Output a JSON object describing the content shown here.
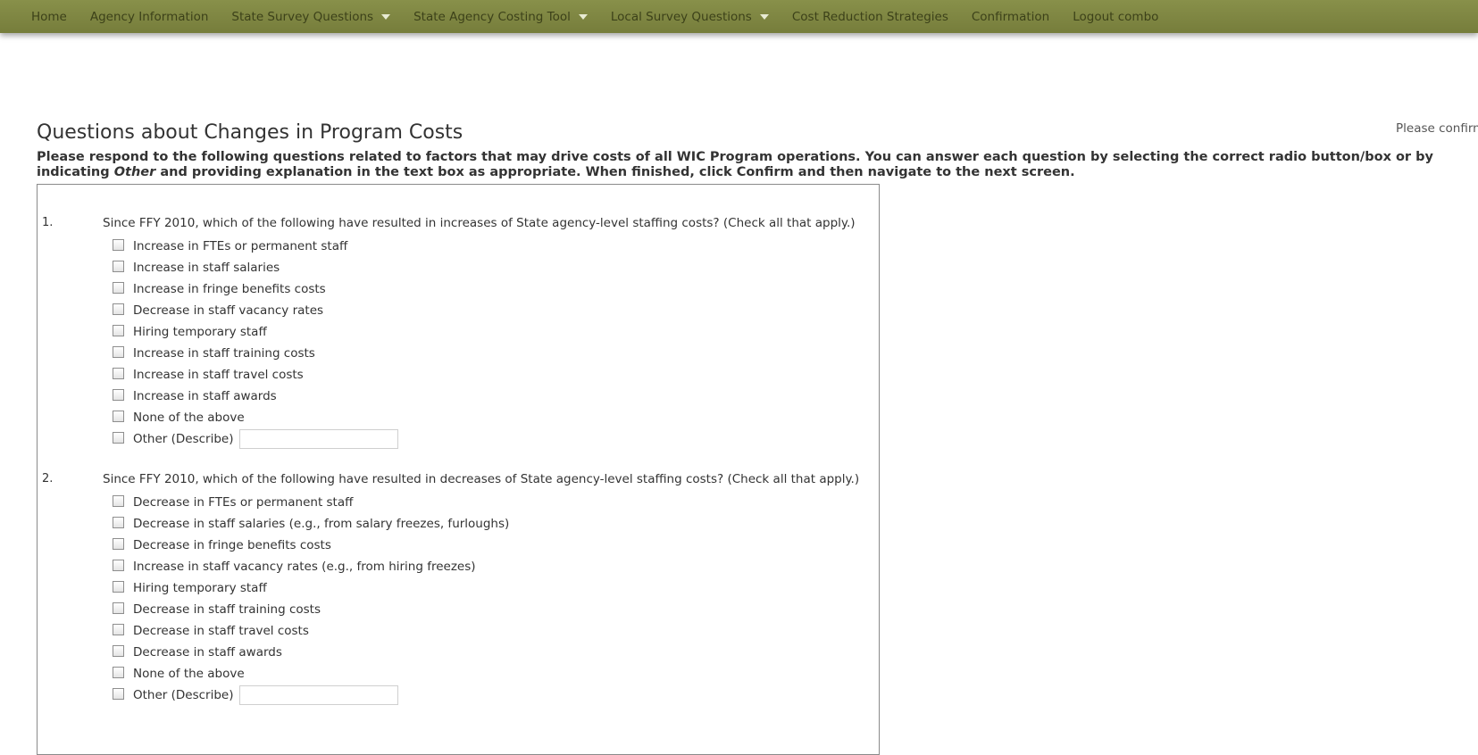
{
  "nav": {
    "items": [
      {
        "label": "Home",
        "dropdown": false
      },
      {
        "label": "Agency Information",
        "dropdown": false
      },
      {
        "label": "State Survey Questions",
        "dropdown": true
      },
      {
        "label": "State Agency Costing Tool",
        "dropdown": true
      },
      {
        "label": "Local Survey Questions",
        "dropdown": true
      },
      {
        "label": "Cost Reduction Strategies",
        "dropdown": false
      },
      {
        "label": "Confirmation",
        "dropdown": false
      },
      {
        "label": "Logout combo",
        "dropdown": false
      }
    ]
  },
  "colors": {
    "nav_background": "#7f8642",
    "nav_text": "#3c4119",
    "box_border": "#8a8a8a"
  },
  "page": {
    "title": "Questions about Changes in Program Costs",
    "confirm_note": "Please confirm",
    "instructions_part1": "Please respond to the following questions related to factors that may drive costs of all WIC Program operations. You can answer each question by selecting the correct radio button/box or by indicating",
    "instructions_italic": "Other",
    "instructions_part2": "and providing explanation in the text box as appropriate. When finished, click Confirm and then navigate to the next screen."
  },
  "questions": [
    {
      "number": "1.",
      "text": "Since FFY 2010, which of the following have resulted in increases of State agency-level staffing costs? (Check all that apply.)",
      "options": [
        "Increase in FTEs or permanent staff",
        "Increase in staff salaries",
        "Increase in fringe benefits costs",
        "Decrease in staff vacancy rates",
        "Hiring temporary staff",
        "Increase in staff training costs",
        "Increase in staff travel costs",
        "Increase in staff awards",
        "None of the above"
      ],
      "other_label": "Other (Describe)",
      "other_value": ""
    },
    {
      "number": "2.",
      "text": "Since FFY 2010, which of the following have resulted in decreases of State agency-level staffing costs? (Check all that apply.)",
      "options": [
        "Decrease in FTEs or permanent staff",
        "Decrease in staff salaries (e.g., from salary freezes, furloughs)",
        "Decrease in fringe benefits costs",
        "Increase in staff vacancy rates (e.g., from hiring freezes)",
        "Hiring temporary staff",
        "Decrease in staff training costs",
        "Decrease in staff travel costs",
        "Decrease in staff awards",
        "None of the above"
      ],
      "other_label": "Other (Describe)",
      "other_value": ""
    }
  ]
}
